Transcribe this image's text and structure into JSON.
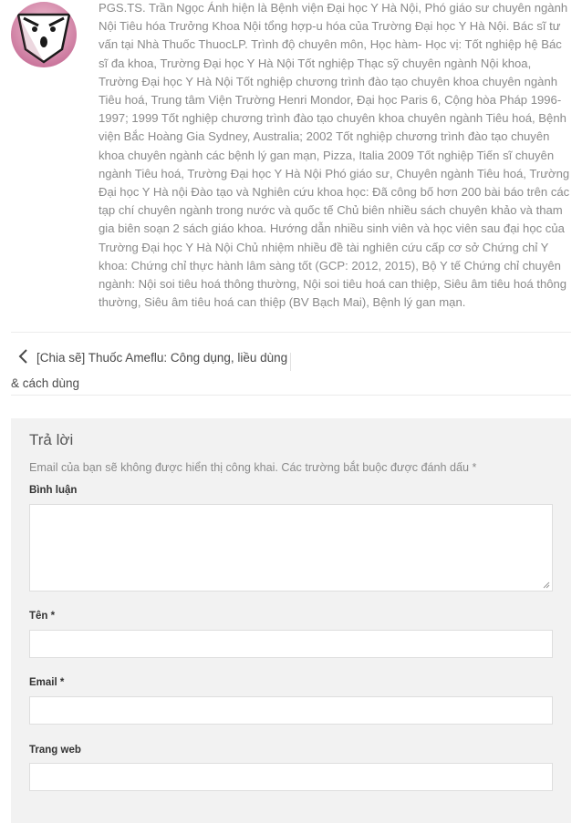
{
  "author": {
    "avatar_icon": "gravatar-face-icon",
    "bio": "PGS.TS. Trần Ngọc Ánh hiện là Bệnh viện Đại học Y Hà Nội, Phó giáo sư chuyên ngành Nội Tiêu hóa Trưởng Khoa Nội tổng hợp-u hóa của Trường Đại học Y Hà Nội. Bác sĩ tư vấn tại Nhà Thuốc ThuocLP. Trình độ chuyên môn, Học hàm- Học vị: Tốt nghiệp hệ Bác sĩ đa khoa, Trường Đại học Y Hà Nội Tốt nghiệp Thạc sỹ chuyên ngành Nội khoa, Trường Đại học Y Hà Nội Tốt nghiệp chương trình đào tạo chuyên khoa chuyên ngành Tiêu hoá, Trung tâm Viện Trường Henri Mondor, Đại học Paris 6, Cộng hòa Pháp 1996-1997; 1999 Tốt nghiệp chương trình đào tạo chuyên khoa chuyên ngành Tiêu hoá, Bệnh viện Bắc Hoàng Gia Sydney, Australia; 2002 Tốt nghiệp chương trình đào tạo chuyên khoa chuyên ngành các bệnh lý gan mạn, Pizza, Italia 2009 Tốt nghiệp Tiến sĩ chuyên ngành Tiêu hoá, Trường Đại học Y Hà Nội Phó giáo sư, Chuyên ngành Tiêu hoá, Trường Đại học Y Hà nội Đào tạo và Nghiên cứu khoa học: Đã công bố hơn 200 bài báo trên các tạp chí chuyên ngành trong nước và quốc tế Chủ biên nhiều sách chuyên khảo và tham gia biên soạn 2 sách giáo khoa. Hướng dẫn nhiều sinh viên và học viên sau đại học của Trường Đại học Y Hà Nội Chủ nhiệm nhiều đề tài nghiên cứu cấp cơ sở Chứng chỉ Y khoa: Chứng chỉ thực hành lâm sàng tốt (GCP: 2012, 2015), Bộ Y tế Chứng chỉ chuyên ngành: Nội soi tiêu hoá thông thường, Nội soi tiêu hoá can thiệp, Siêu âm tiêu hoá thông thường, Siêu âm tiêu hoá can thiệp (BV Bạch Mai), Bệnh lý gan mạn."
  },
  "post_nav": {
    "prev_icon": "chevron-left-icon",
    "prev_label": "[Chia sẽ] Thuốc Ameflu: Công dụng, liều dùng & cách dùng"
  },
  "comment_form": {
    "title": "Trả lời",
    "notes": "Email của bạn sẽ không được hiển thị công khai. Các trường bắt buộc được đánh dấu",
    "required_mark": "*",
    "comment_label": "Bình luận",
    "name_label": "Tên *",
    "email_label": "Email *",
    "url_label": "Trang web",
    "comment_value": "",
    "name_value": "",
    "email_value": "",
    "url_value": ""
  },
  "colors": {
    "form_background": "#f2f2f2",
    "text_muted": "#8a8a8a",
    "avatar_background": "#d08aa6"
  }
}
